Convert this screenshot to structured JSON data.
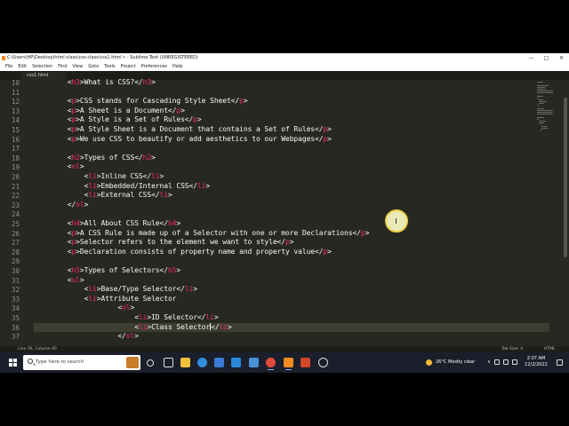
{
  "window": {
    "title": "C:\\Users\\HP\\Desktop\\html-class\\css-class\\css1.html • - Sublime Text (UNREGISTERED)",
    "controls": [
      "—",
      "□",
      "✕"
    ]
  },
  "menu": [
    "File",
    "Edit",
    "Selection",
    "Find",
    "View",
    "Goto",
    "Tools",
    "Project",
    "Preferences",
    "Help"
  ],
  "tab": {
    "label": "css1.html"
  },
  "editor": {
    "lines": [
      {
        "n": "10",
        "text": "        <h3>What is CSS?</h3>"
      },
      {
        "n": "11",
        "text": ""
      },
      {
        "n": "12",
        "text": "        <p>CSS stands for Cascading Style Sheet</p>"
      },
      {
        "n": "13",
        "text": "        <p>A Sheet is a Document</p>"
      },
      {
        "n": "14",
        "text": "        <p>A Style is a Set of Rules</p>"
      },
      {
        "n": "15",
        "text": "        <p>A Style Sheet is a Document that contains a Set of Rules</p>"
      },
      {
        "n": "16",
        "text": "        <p>We use CSS to beautify or add aesthetics to our Webpages</p>"
      },
      {
        "n": "17",
        "text": ""
      },
      {
        "n": "18",
        "text": "        <h2>Types of CSS</h2>"
      },
      {
        "n": "19",
        "text": "        <ol>"
      },
      {
        "n": "20",
        "text": "            <li>Inline CSS</li>"
      },
      {
        "n": "21",
        "text": "            <li>Embedded/Internal CSS</li>"
      },
      {
        "n": "22",
        "text": "            <li>External CSS</li>"
      },
      {
        "n": "23",
        "text": "        </ol>"
      },
      {
        "n": "24",
        "text": ""
      },
      {
        "n": "25",
        "text": "        <h4>All About CSS Rule</h4>"
      },
      {
        "n": "26",
        "text": "        <p>A CSS Rule is made up of a Selector with one or more Declarations</p>"
      },
      {
        "n": "27",
        "text": "        <p>Selector refers to the element we want to style</p>"
      },
      {
        "n": "28",
        "text": "        <p>Declaration consists of property name and property value</p>"
      },
      {
        "n": "29",
        "text": ""
      },
      {
        "n": "30",
        "text": "        <h5>Types of Selectors</h5>"
      },
      {
        "n": "31",
        "text": "        <ul>"
      },
      {
        "n": "32",
        "text": "            <li>Base/Type Selector</li>"
      },
      {
        "n": "33",
        "text": "            <li>Attribute Selector"
      },
      {
        "n": "34",
        "text": "                    <ol>"
      },
      {
        "n": "35",
        "text": "                        <li>ID Selector</li>"
      },
      {
        "n": "36",
        "text": "                        <li>Class Selector</li>",
        "active": true
      },
      {
        "n": "37",
        "text": "                    </ol>"
      }
    ],
    "cursor_line": "36"
  },
  "status": {
    "left": "Line 36, Column 40",
    "tab_size": "Tab Size: 4",
    "syntax": "HTML"
  },
  "taskbar": {
    "search_placeholder": "Type here to search",
    "weather": "26°C  Mostly clear",
    "time": "2:07 AM",
    "date": "12/2/2022"
  },
  "colors": {
    "editor_bg": "#272822",
    "tag": "#f92672",
    "text": "#f8f8f2",
    "line_number": "#90908a",
    "taskbar_bg": "#1a1f2b"
  }
}
